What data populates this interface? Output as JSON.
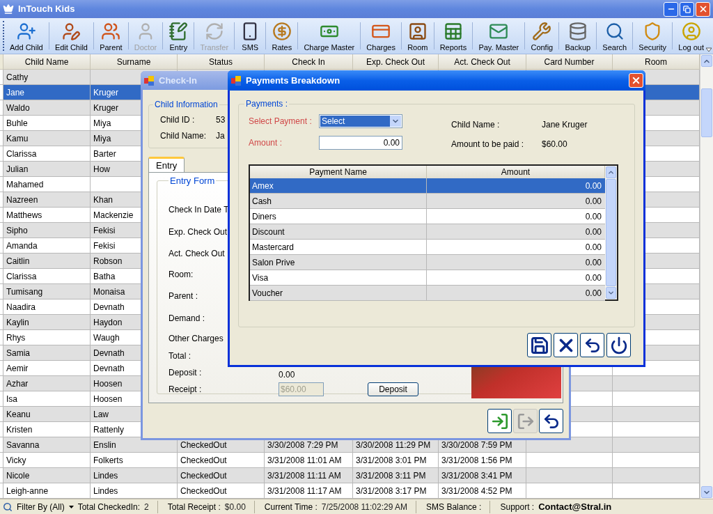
{
  "window": {
    "title": "InTouch Kids"
  },
  "toolbar": [
    {
      "label": "Add Child",
      "disabled": false
    },
    {
      "label": "Edit Child",
      "disabled": false
    },
    {
      "label": "Parent",
      "disabled": false
    },
    {
      "label": "Doctor",
      "disabled": true
    },
    {
      "label": "Entry",
      "disabled": false
    },
    {
      "label": "Transfer",
      "disabled": true
    },
    {
      "label": "SMS",
      "disabled": false
    },
    {
      "label": "Rates",
      "disabled": false
    },
    {
      "label": "Charge Master",
      "disabled": false
    },
    {
      "label": "Charges",
      "disabled": false
    },
    {
      "label": "Room",
      "disabled": false
    },
    {
      "label": "Reports",
      "disabled": false
    },
    {
      "label": "Pay. Master",
      "disabled": false
    },
    {
      "label": "Config",
      "disabled": false
    },
    {
      "label": "Backup",
      "disabled": false
    },
    {
      "label": "Search",
      "disabled": false
    },
    {
      "label": "Security",
      "disabled": false
    },
    {
      "label": "Log out",
      "disabled": false
    }
  ],
  "grid": {
    "columns": [
      "Child Name",
      "Surname",
      "Status",
      "Check In",
      "Exp. Check Out",
      "Act. Check Out",
      "Card Number",
      "Room"
    ],
    "rows": [
      {
        "child_name": "Cathy",
        "selected": false
      },
      {
        "child_name": "Jane",
        "surname": "Kruger",
        "selected": true
      },
      {
        "child_name": "Waldo",
        "surname": "Kruger",
        "selected": false
      },
      {
        "child_name": "Buhle",
        "surname": "Miya",
        "selected": false
      },
      {
        "child_name": "Kamu",
        "surname": "Miya",
        "selected": false
      },
      {
        "child_name": "Clarissa",
        "surname": "Barter",
        "selected": false
      },
      {
        "child_name": "Julian",
        "surname": "How",
        "selected": false
      },
      {
        "child_name": "Mahamed",
        "selected": false
      },
      {
        "child_name": "Nazreen",
        "surname": "Khan",
        "selected": false
      },
      {
        "child_name": "Matthews",
        "surname": "Mackenzie",
        "selected": false
      },
      {
        "child_name": "Sipho",
        "surname": "Fekisi",
        "selected": false
      },
      {
        "child_name": "Amanda",
        "surname": "Fekisi",
        "selected": false
      },
      {
        "child_name": "Caitlin",
        "surname": "Robson",
        "selected": false
      },
      {
        "child_name": "Clarissa",
        "surname": "Batha",
        "selected": false
      },
      {
        "child_name": "Tumisang",
        "surname": "Monaisa",
        "selected": false
      },
      {
        "child_name": "Naadira",
        "surname": "Devnath",
        "selected": false
      },
      {
        "child_name": "Kaylin",
        "surname": "Haydon",
        "selected": false
      },
      {
        "child_name": "Rhys",
        "surname": "Waugh",
        "selected": false
      },
      {
        "child_name": "Samia",
        "surname": "Devnath",
        "selected": false
      },
      {
        "child_name": "Aemir",
        "surname": "Devnath",
        "selected": false
      },
      {
        "child_name": "Azhar",
        "surname": "Hoosen",
        "selected": false
      },
      {
        "child_name": "Isa",
        "surname": "Hoosen",
        "selected": false
      },
      {
        "child_name": "Keanu",
        "surname": "Law",
        "selected": false
      },
      {
        "child_name": "Kristen",
        "surname": "Rattenly",
        "selected": false
      },
      {
        "child_name": "Savanna",
        "surname": "Enslin",
        "status": "CheckedOut",
        "check_in": "3/30/2008 7:29 PM",
        "exp_check_out": "3/30/2008 11:29 PM",
        "act_check_out": "3/30/2008 7:59 PM",
        "selected": false
      },
      {
        "child_name": "Vicky",
        "surname": "Folkerts",
        "status": "CheckedOut",
        "check_in": "3/31/2008 11:01 AM",
        "exp_check_out": "3/31/2008 3:01 PM",
        "act_check_out": "3/31/2008 1:56 PM",
        "selected": false
      },
      {
        "child_name": "Nicole",
        "surname": "Lindes",
        "status": "CheckedOut",
        "check_in": "3/31/2008 11:11 AM",
        "exp_check_out": "3/31/2008 3:11 PM",
        "act_check_out": "3/31/2008 3:41 PM",
        "selected": false
      },
      {
        "child_name": "Leigh-anne",
        "surname": "Lindes",
        "status": "CheckedOut",
        "check_in": "3/31/2008 11:17 AM",
        "exp_check_out": "3/31/2008 3:17 PM",
        "act_check_out": "3/31/2008 4:52 PM",
        "selected": false
      }
    ]
  },
  "check_in_dialog": {
    "title": "Check-In",
    "child_info": {
      "legend": "Child Information",
      "fields": [
        {
          "label": "Child ID :",
          "value": "53"
        },
        {
          "label": "Child Name:",
          "value": "Ja"
        }
      ]
    },
    "tabs": [
      {
        "label": "Entry",
        "selected": true
      }
    ],
    "entry_form": {
      "legend": "Entry Form",
      "labels": [
        "Check In Date T",
        "Exp. Check Out",
        "Act. Check Out",
        "Room:",
        "Parent :",
        "Demand :",
        "Other Charges",
        "Total :",
        "Deposit :",
        "Receipt :"
      ],
      "deposit_value": "0.00",
      "receipt": {
        "value": "$60.00",
        "disabled": true
      },
      "deposit_button": "Deposit"
    },
    "footer_buttons": [
      {
        "kind": "checkin",
        "disabled": false
      },
      {
        "kind": "checkout",
        "disabled": true
      },
      {
        "kind": "undo",
        "disabled": false
      }
    ]
  },
  "payments_dialog": {
    "title": "Payments Breakdown",
    "legend": "Payments :",
    "select_label": "Select Payment :",
    "select_value": "Select",
    "amount_label": "Amount :",
    "amount_value": "0.00",
    "child_name_label": "Child Name :",
    "child_name": "Jane Kruger",
    "due_label": "Amount to be paid :",
    "due": "$60.00",
    "columns": [
      "Payment Name",
      "Amount"
    ],
    "rows": [
      {
        "name": "Amex",
        "amount": "0.00",
        "selected": true
      },
      {
        "name": "Cash",
        "amount": "0.00",
        "selected": false
      },
      {
        "name": "Diners",
        "amount": "0.00",
        "selected": false
      },
      {
        "name": "Discount",
        "amount": "0.00",
        "selected": false
      },
      {
        "name": "Mastercard",
        "amount": "0.00",
        "selected": false
      },
      {
        "name": "Salon Prive",
        "amount": "0.00",
        "selected": false
      },
      {
        "name": "Visa",
        "amount": "0.00",
        "selected": false
      },
      {
        "name": "Voucher",
        "amount": "0.00",
        "selected": false
      }
    ],
    "buttons": [
      {
        "kind": "save"
      },
      {
        "kind": "cancel"
      },
      {
        "kind": "undo"
      },
      {
        "kind": "power"
      }
    ]
  },
  "status_bar": {
    "filter": "Filter By (All)",
    "items": [
      {
        "label": "Total CheckedIn:",
        "value": "2",
        "bold": false
      },
      {
        "label": "Total Receipt :",
        "value": "$0.00",
        "bold": false
      },
      {
        "label": "Current Time :",
        "value": "7/25/2008 11:02:29 AM",
        "bold": false
      },
      {
        "label": "SMS Balance :",
        "bold": false
      },
      {
        "label": "Support :",
        "value": "Contact@Stral.in",
        "bold": true
      }
    ]
  }
}
